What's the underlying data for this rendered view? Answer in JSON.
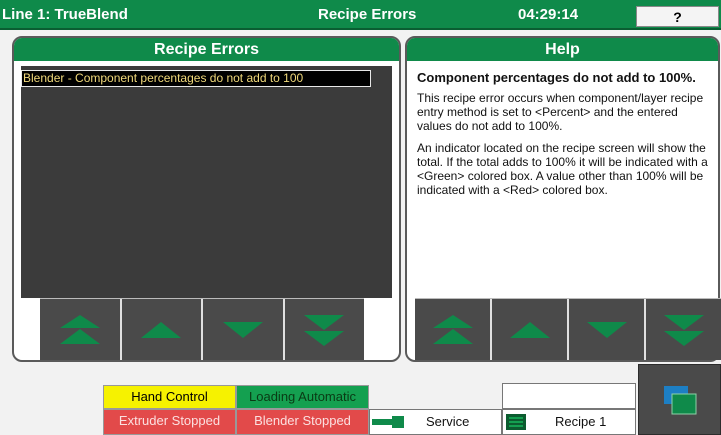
{
  "titlebar": {
    "line_label": "Line 1: TrueBlend",
    "screen_title": "Recipe Errors",
    "time": "04:29:14",
    "help_button": "?"
  },
  "errors_panel": {
    "title": "Recipe Errors",
    "items": [
      "Blender - Component percentages do not add to 100"
    ]
  },
  "help_panel": {
    "title": "Help",
    "heading": "Component percentages do not add to 100%.",
    "paragraphs": [
      "This recipe error occurs when component/layer recipe entry method is set to <Percent> and the entered values do not add to 100%.",
      "An indicator located on the recipe screen will show the total. If the total adds to 100% it will be indicated with a <Green> colored box.  A value other than 100% will be indicated with a <Red> colored box."
    ]
  },
  "scroll_buttons": {
    "icons": [
      "page-up-icon",
      "up-icon",
      "down-icon",
      "page-down-icon"
    ]
  },
  "status": {
    "hand_control": "Hand Control",
    "loading_automatic": "Loading Automatic",
    "extruder": "Extruder Stopped",
    "blender": "Blender Stopped",
    "service": "Service",
    "recipe": "Recipe 1"
  },
  "colors": {
    "title_green": "#0f8a4a",
    "error_text": "#f1d97a",
    "status_yellow": "#f6f200",
    "status_green": "#14a050",
    "status_red": "#e24a4a"
  }
}
